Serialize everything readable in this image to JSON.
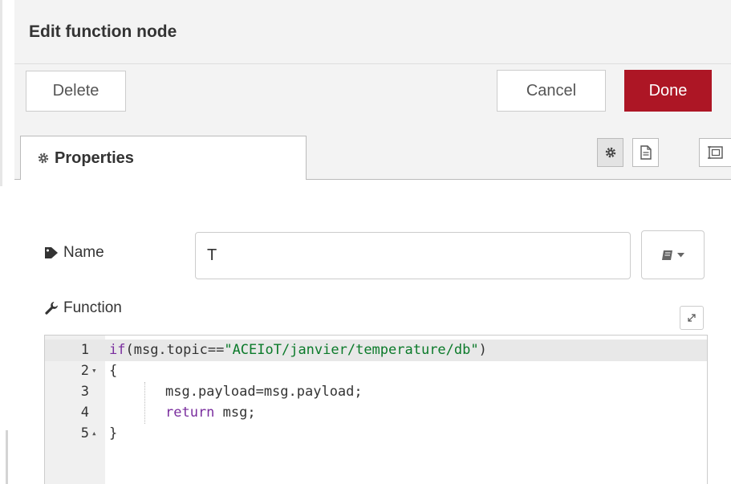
{
  "dialog": {
    "title": "Edit function node",
    "buttons": {
      "delete": "Delete",
      "cancel": "Cancel",
      "done": "Done"
    }
  },
  "tabs": {
    "properties_label": "Properties",
    "icons": [
      "gear-icon",
      "description-icon",
      "appearance-icon"
    ]
  },
  "form": {
    "name_label": "Name",
    "name_value": "T",
    "function_label": "Function"
  },
  "editor": {
    "lines": [
      {
        "number": "1",
        "fold": ""
      },
      {
        "number": "2",
        "fold": "▾"
      },
      {
        "number": "3",
        "fold": ""
      },
      {
        "number": "4",
        "fold": ""
      },
      {
        "number": "5",
        "fold": "▴"
      }
    ],
    "tokens": {
      "if_kw": "if",
      "cond_open": "(msg.topic",
      "eq": "==",
      "topic_string": "\"ACEIoT/janvier/temperature/db\"",
      "cond_close": ")",
      "brace_open": "{",
      "assign_stmt": "msg.payload=msg.payload;",
      "return_kw": "return",
      "return_val": " msg;",
      "brace_close": "}"
    }
  },
  "colors": {
    "done_button": "#ad1625",
    "keyword": "#7a2e9e",
    "string": "#0b7a2a"
  }
}
